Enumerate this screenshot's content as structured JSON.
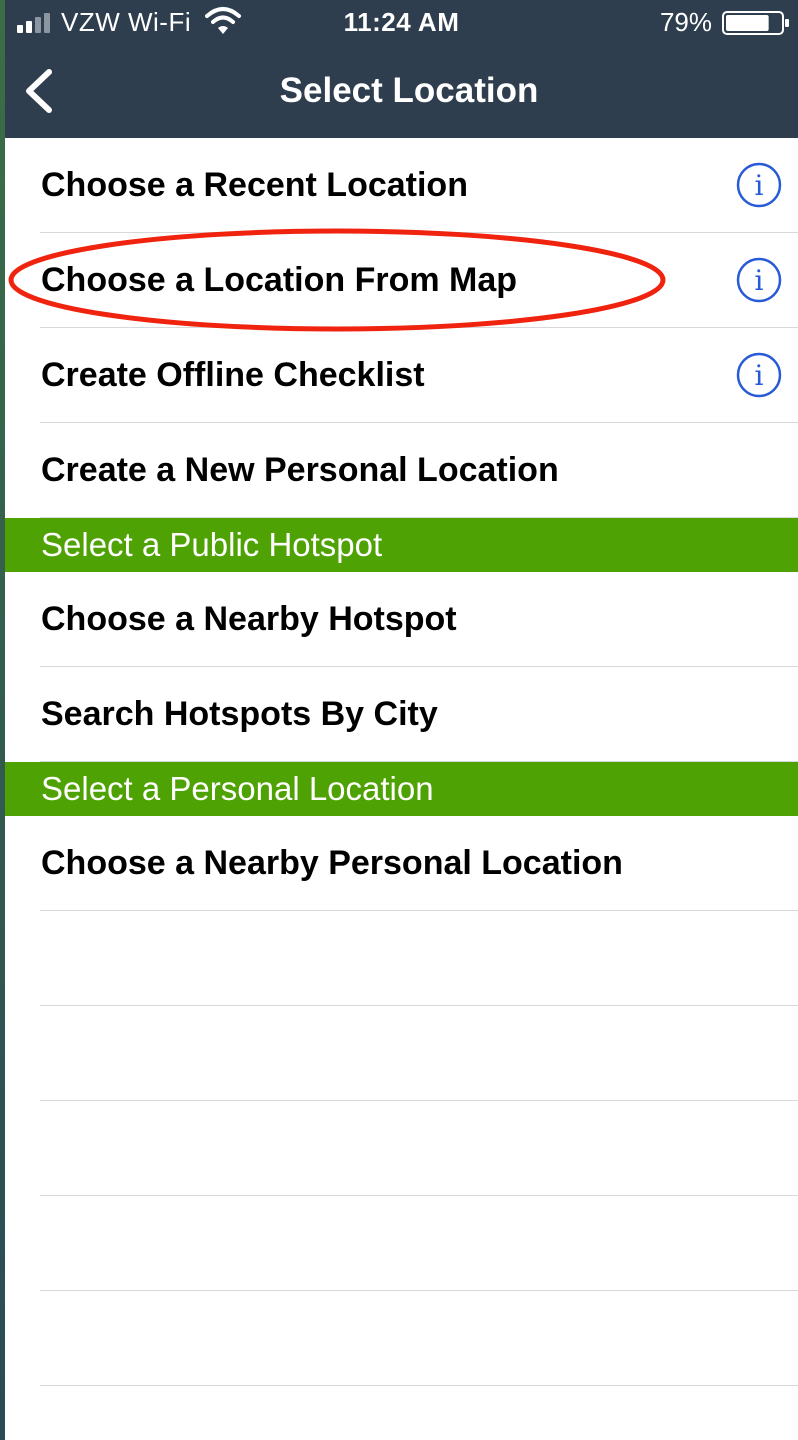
{
  "status_bar": {
    "carrier": "VZW Wi-Fi",
    "time": "11:24 AM",
    "battery_percent": "79%",
    "battery_level": 0.79,
    "signal_bars_filled": 2,
    "signal_bars_total": 4
  },
  "nav": {
    "title": "Select Location",
    "back_icon": "chevron-left-icon"
  },
  "list": {
    "items": [
      {
        "label": "Choose a Recent Location",
        "info_icon": "info-circle-icon"
      },
      {
        "label": "Choose a Location From Map",
        "info_icon": "info-circle-icon",
        "highlighted": true
      },
      {
        "label": "Create Offline Checklist",
        "info_icon": "info-circle-icon"
      },
      {
        "label": "Create a New Personal Location"
      }
    ],
    "sections": [
      {
        "title": "Select a Public Hotspot",
        "items": [
          {
            "label": "Choose a Nearby Hotspot"
          },
          {
            "label": "Search Hotspots By City"
          }
        ]
      },
      {
        "title": "Select a Personal Location",
        "items": [
          {
            "label": "Choose a Nearby Personal Location"
          }
        ]
      }
    ]
  },
  "colors": {
    "header_bg": "#2f3e4e",
    "section_bg": "#4ea203",
    "info_blue": "#2a5bd7",
    "annotation_red": "#f0230f"
  }
}
